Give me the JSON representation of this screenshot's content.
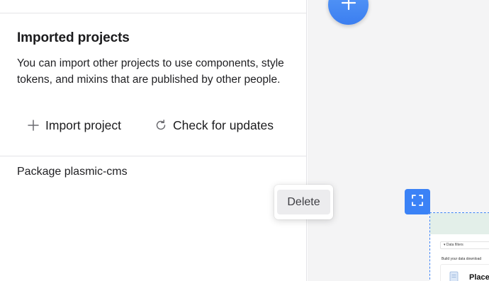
{
  "imported_projects": {
    "title": "Imported projects",
    "description": "You can import other projects to use components, style tokens, and mixins that are published by other people.",
    "actions": {
      "import_label": "Import project",
      "update_label": "Check for updates"
    },
    "packages": [
      {
        "label": "Package plasmic-cms"
      }
    ]
  },
  "context_menu": {
    "items": [
      {
        "label": "Delete"
      }
    ]
  },
  "artboard": {
    "filter_label": "Data filters",
    "subtitle": "Build your data download",
    "card_label": "Place"
  },
  "colors": {
    "accent": "#3b82f6",
    "fab": "#4a8ef5",
    "menu_hover": "#ececee"
  },
  "icons": {
    "fab": "plus-icon",
    "import": "plus-icon",
    "update": "refresh-icon",
    "focus": "fullscreen-icon"
  }
}
